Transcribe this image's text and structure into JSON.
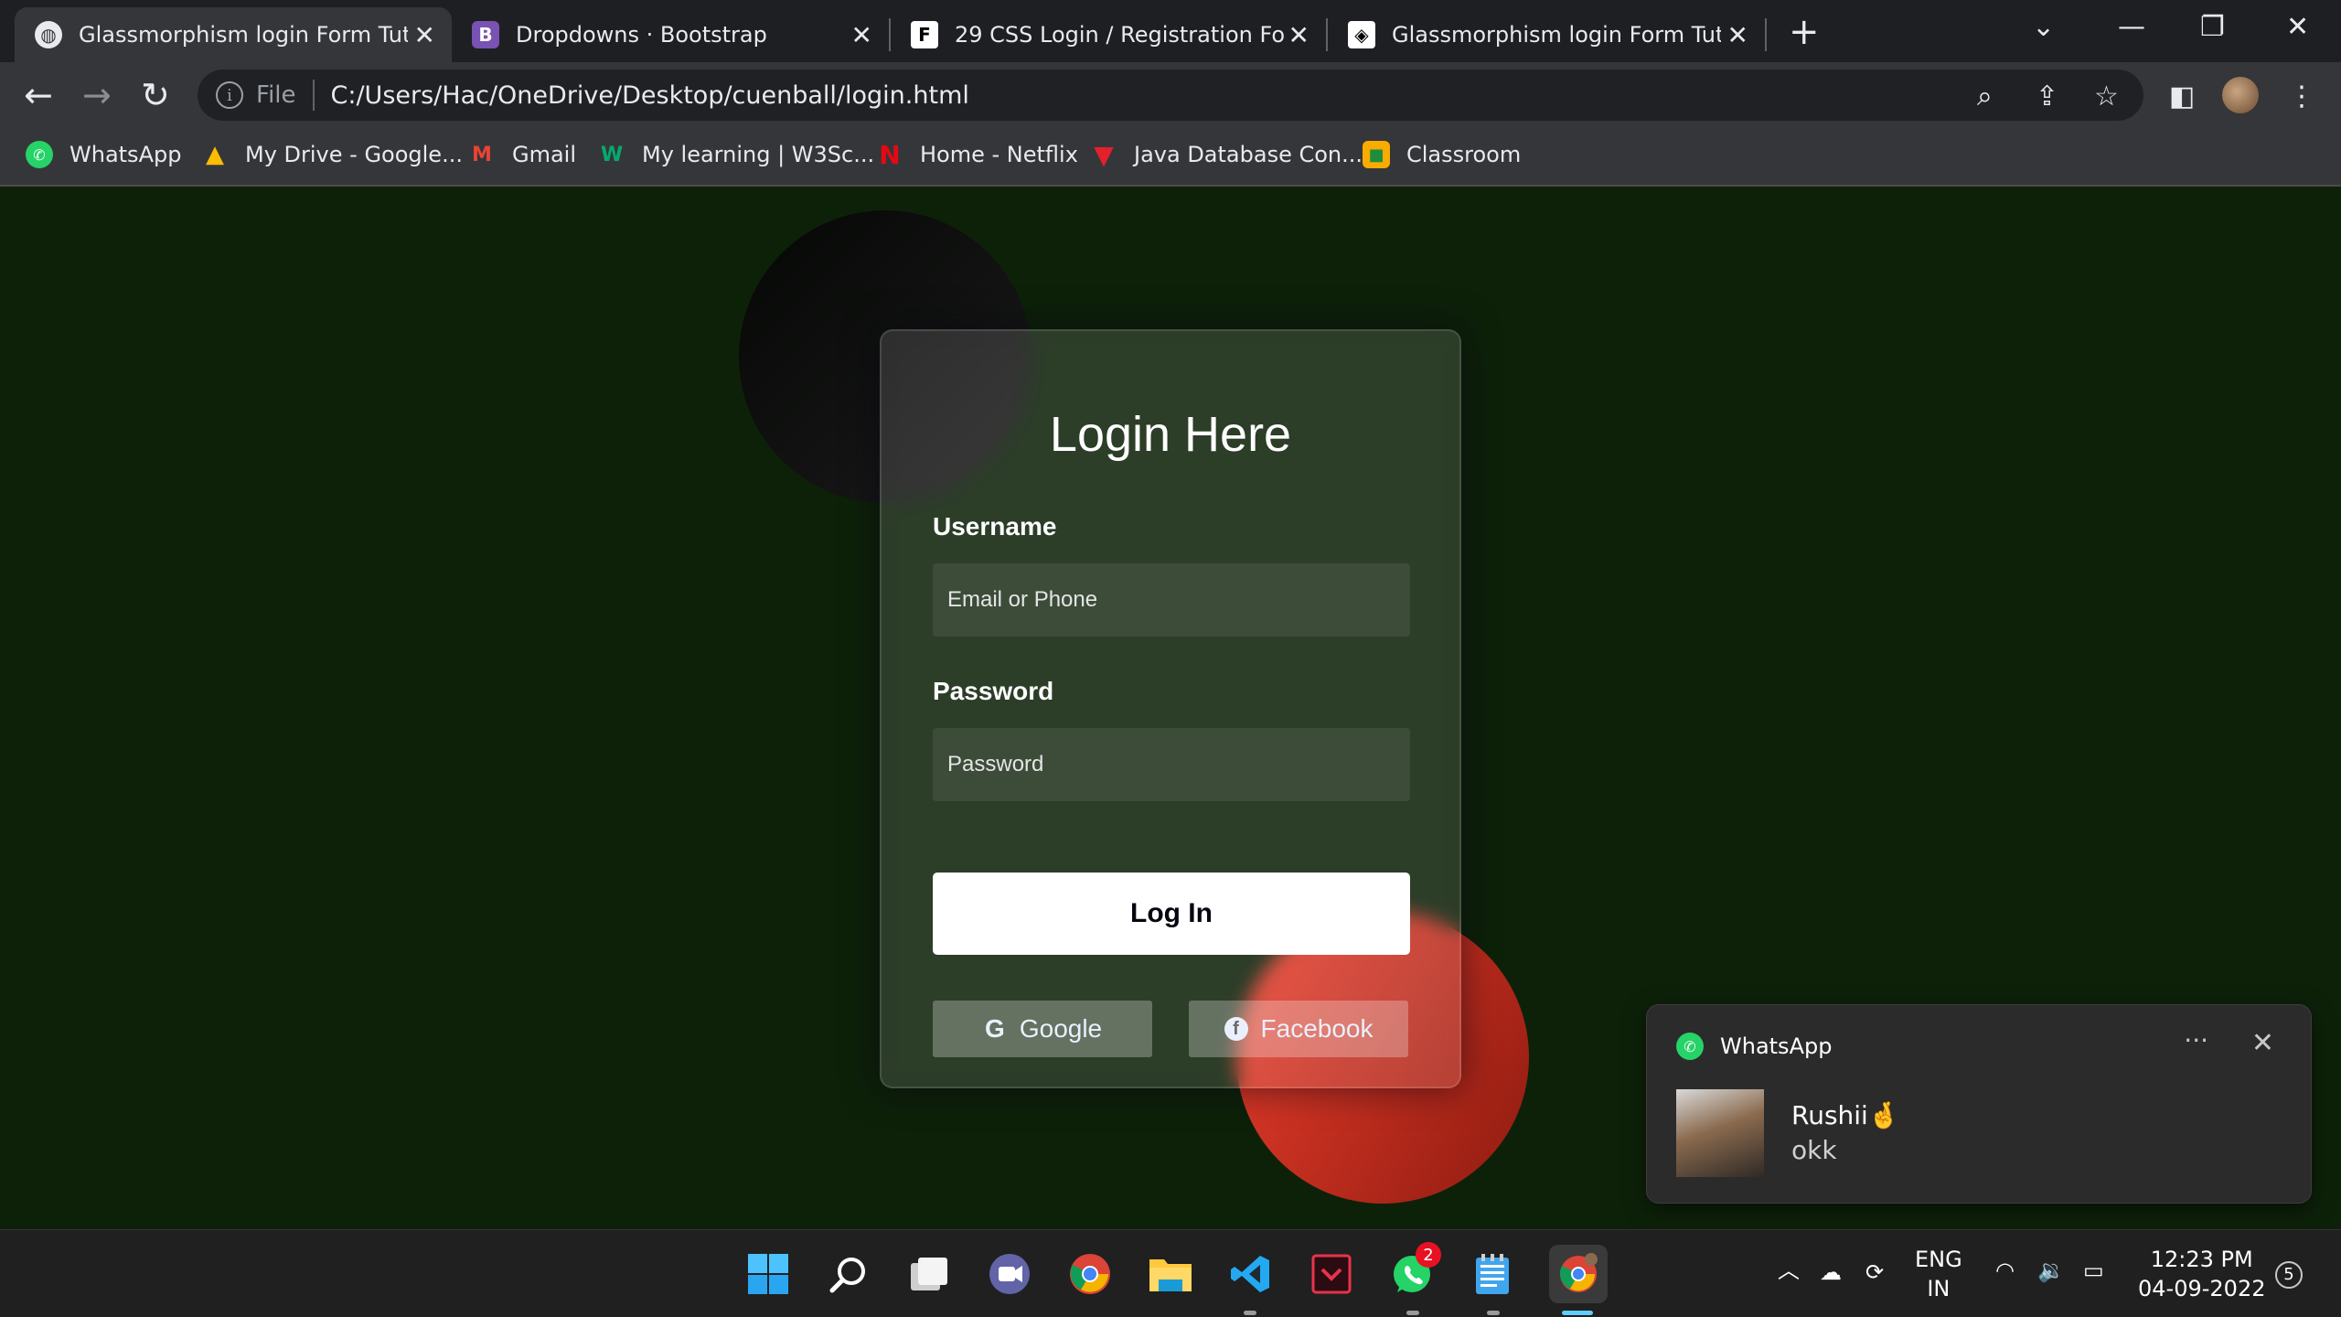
{
  "tabs": [
    {
      "title": "Glassmorphism login Form Tutorial",
      "icon": "globe-icon"
    },
    {
      "title": "Dropdowns · Bootstrap",
      "icon": "bootstrap-icon"
    },
    {
      "title": "29 CSS Login / Registration Forms",
      "icon": "freefrontend-icon"
    },
    {
      "title": "Glassmorphism login Form Tutorial",
      "icon": "codepen-icon"
    }
  ],
  "toolbar": {
    "scheme": "File",
    "url": "C:/Users/Hac/OneDrive/Desktop/cuenball/login.html"
  },
  "bookmarks": [
    {
      "label": "WhatsApp",
      "icon": "whatsapp-icon",
      "color": "#25d366"
    },
    {
      "label": "My Drive - Google...",
      "icon": "google-drive-icon",
      "color": "#fbbc04"
    },
    {
      "label": "Gmail",
      "icon": "gmail-icon",
      "color": "#ea4335"
    },
    {
      "label": "My learning | W3Sc...",
      "icon": "w3schools-icon",
      "color": "#04aa6d"
    },
    {
      "label": "Home - Netflix",
      "icon": "netflix-icon",
      "color": "#e50914"
    },
    {
      "label": "Java Database Con...",
      "icon": "java-tpoint-icon",
      "color": "#e4202b"
    },
    {
      "label": "Classroom",
      "icon": "classroom-icon",
      "color": "#f9ab00"
    }
  ],
  "login": {
    "title": "Login Here",
    "username_label": "Username",
    "username_placeholder": "Email or Phone",
    "password_label": "Password",
    "password_placeholder": "Password",
    "login_button": "Log In",
    "google_button": "Google",
    "facebook_button": "Facebook"
  },
  "notification": {
    "app": "WhatsApp",
    "sender": "Rushii🤞",
    "message": "okk"
  },
  "taskbar": {
    "whatsapp_badge": "2",
    "lang_top": "ENG",
    "lang_bottom": "IN",
    "time": "12:23 PM",
    "date": "04-09-2022",
    "notif_count": "5"
  },
  "colors": {
    "page_bg": "#0d2109",
    "accent_red": "#e23b29",
    "card_bg": "rgba(255,255,255,0.13)"
  }
}
